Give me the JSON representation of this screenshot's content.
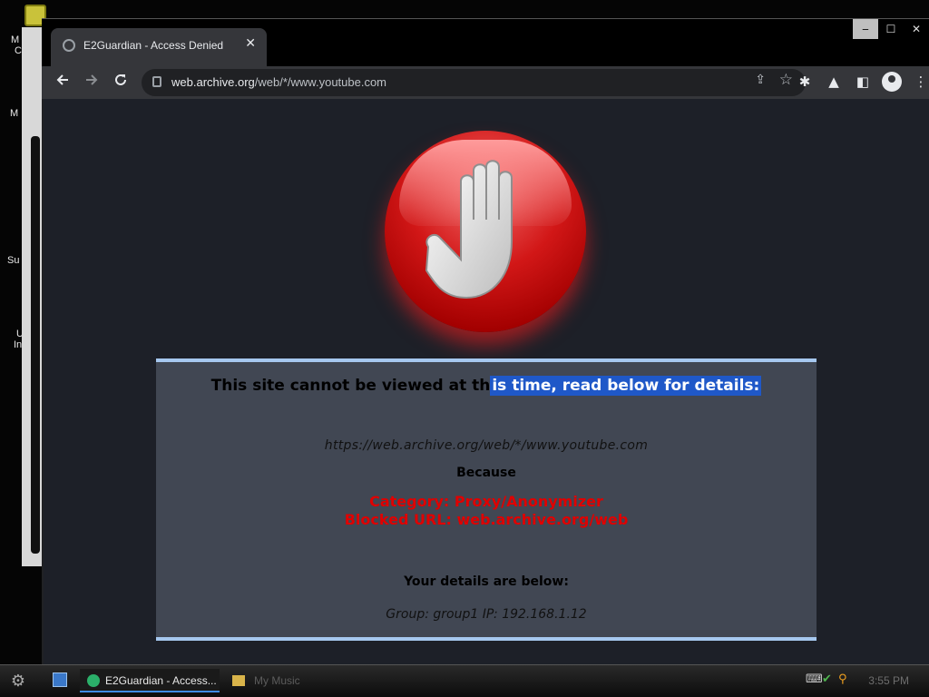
{
  "desktop": {
    "labels": [
      "M",
      "C",
      "M",
      "Su",
      "U",
      "In"
    ]
  },
  "browser": {
    "tab_title": "E2Guardian - Access Denied",
    "tab_close": "✕",
    "window_controls": {
      "minimize": "‒",
      "maximize": "☐",
      "close": "✕"
    },
    "url_host": "web.archive.org",
    "url_path": "/web/*/www.youtube.com"
  },
  "page": {
    "heading_part1": "This site cannot be viewed at th",
    "heading_selected": "is time, read below for details:",
    "blocked_url": "https://web.archive.org/web/*/www.youtube.com",
    "because": "Because",
    "category": "Category: Proxy/Anonymizer",
    "blocked_rule": "Blocked URL: web.archive.org/web",
    "details_title": "Your details are below:",
    "group_ip": "Group: group1   IP: 192.168.1.12"
  },
  "taskbar": {
    "active_task": "E2Guardian - Access...",
    "inactive_task": "My Music",
    "clock": "3:55 PM"
  },
  "colors": {
    "accent_blue": "#a6c8ef",
    "error_red": "#e00000",
    "selection": "#1f58c8"
  }
}
